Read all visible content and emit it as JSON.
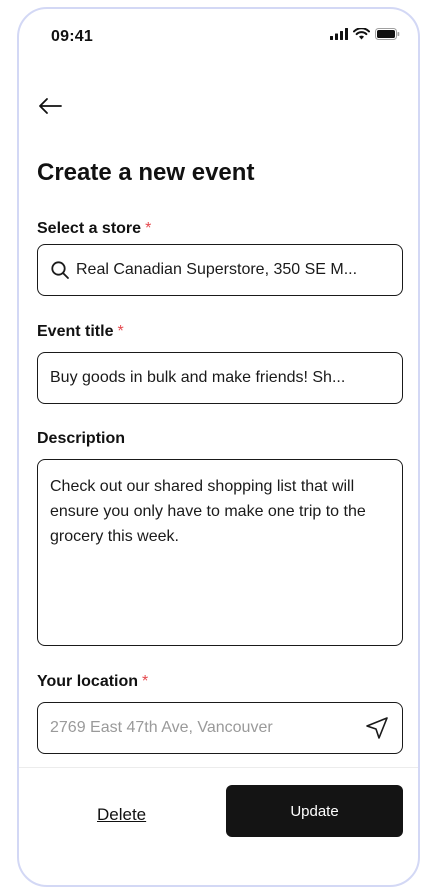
{
  "status_bar": {
    "time": "09:41",
    "icons": [
      "cellular-signal-icon",
      "wifi-icon",
      "battery-icon"
    ]
  },
  "header": {
    "back_icon": "arrow-left-icon",
    "title": "Create a new event"
  },
  "form": {
    "store": {
      "label": "Select a store",
      "required": "*",
      "icon": "search-icon",
      "value": "Real Canadian Superstore, 350 SE M..."
    },
    "event_title": {
      "label": "Event title",
      "required": "*",
      "value": "Buy goods in bulk and make friends! Sh..."
    },
    "description": {
      "label": "Description",
      "value": "Check out our shared shopping list that will ensure you only have to make one trip to the grocery this week."
    },
    "location": {
      "label": "Your location",
      "required": "*",
      "placeholder": "2769 East 47th Ave, Vancouver",
      "icon": "navigation-arrow-icon"
    }
  },
  "footer": {
    "delete_label": "Delete",
    "update_label": "Update"
  },
  "colors": {
    "primary": "#141414",
    "required": "#e5484d",
    "placeholder": "#9a9a9a",
    "frame_border": "#d3d8f5"
  }
}
